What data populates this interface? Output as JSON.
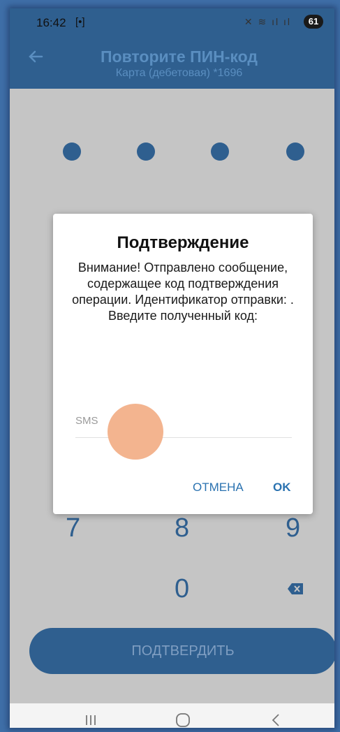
{
  "status_bar": {
    "time": "16:42",
    "cam_glyph": "[•]",
    "icons_text": "✕ ≋ ıl ıl",
    "battery": "61"
  },
  "header": {
    "title": "Повторите ПИН-код",
    "subtitle": "Карта (дебетовая) *1696",
    "back_icon": "arrow-left-icon"
  },
  "pin": {
    "dots_filled": 4
  },
  "keypad": {
    "row_partial": [
      "7",
      "8",
      "9"
    ],
    "zero": "0",
    "backspace_icon": "backspace-icon"
  },
  "confirm_button": "ПОДТВЕРДИТЬ",
  "dialog": {
    "title": "Подтверждение",
    "message": "Внимание! Отправлено сообщение, содержащее код подтверждения операции. Идентификатор отправки: . Введите полученный код:",
    "input_placeholder": "SMS",
    "cancel_label": "ОТМЕНА",
    "ok_label": "OK"
  },
  "nav_bar": {
    "icons": [
      "recent-apps-icon",
      "home-icon",
      "back-icon"
    ]
  },
  "colors": {
    "primary": "#2f5f8f",
    "accent": "#2a72b0",
    "touch_indicator": "#f3b48f"
  }
}
